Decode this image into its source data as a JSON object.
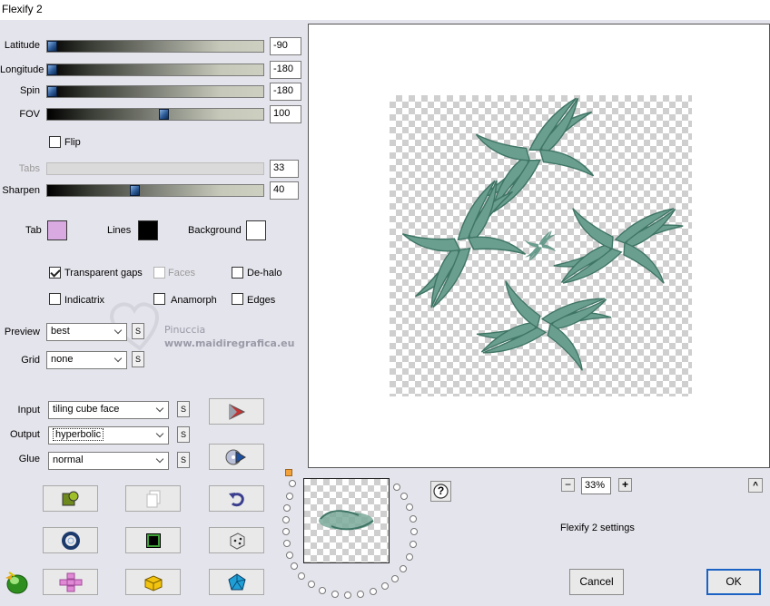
{
  "window": {
    "title": "Flexify 2"
  },
  "sliders": {
    "latitude": {
      "label": "Latitude",
      "value": "-90",
      "position": 0.0
    },
    "longitude": {
      "label": "Longitude",
      "value": "-180",
      "position": 0.0
    },
    "spin": {
      "label": "Spin",
      "value": "-180",
      "position": 0.0
    },
    "fov": {
      "label": "FOV",
      "value": "100",
      "position": 0.54
    },
    "tabs": {
      "label": "Tabs",
      "value": "33",
      "position": 0.0
    },
    "sharpen": {
      "label": "Sharpen",
      "value": "40",
      "position": 0.4
    }
  },
  "flip": {
    "label": "Flip",
    "checked": false
  },
  "colors": {
    "tab": {
      "label": "Tab",
      "color": "#d9a9e2"
    },
    "lines": {
      "label": "Lines",
      "color": "#000000"
    },
    "background": {
      "label": "Background",
      "color": "#ffffff"
    }
  },
  "options": {
    "transparent_gaps": {
      "label": "Transparent gaps",
      "checked": true
    },
    "faces": {
      "label": "Faces",
      "checked": false
    },
    "de_halo": {
      "label": "De-halo",
      "checked": false
    },
    "indicatrix": {
      "label": "Indicatrix",
      "checked": false
    },
    "anamorph": {
      "label": "Anamorph",
      "checked": false
    },
    "edges": {
      "label": "Edges",
      "checked": false
    }
  },
  "preview_select": {
    "label": "Preview",
    "value": "best"
  },
  "grid_select": {
    "label": "Grid",
    "value": "none"
  },
  "input_select": {
    "label": "Input",
    "value": "tiling cube face"
  },
  "output_select": {
    "label": "Output",
    "value": "hyperbolic"
  },
  "glue_select": {
    "label": "Glue",
    "value": "normal"
  },
  "s_label": "S",
  "watermark": {
    "line1": "Pinuccia",
    "line2": "www.maidiregrafica.eu"
  },
  "zoom": {
    "minus": "−",
    "value": "33%",
    "plus": "+"
  },
  "help_label": "?",
  "collapse_label": "^",
  "settings_label": "Flexify 2 settings",
  "buttons": {
    "cancel": "Cancel",
    "ok": "OK"
  },
  "accent": {
    "swirl": "#6a9e8e",
    "swirl_dark": "#3f7565"
  }
}
